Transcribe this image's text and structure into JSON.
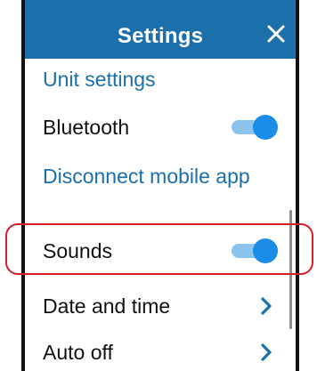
{
  "header": {
    "title": "Settings",
    "close_icon": "close-icon"
  },
  "menu": {
    "unit_settings": "Unit settings",
    "bluetooth": {
      "label": "Bluetooth",
      "toggle_on": true
    },
    "disconnect_app": "Disconnect mobile app",
    "sounds": {
      "label": "Sounds",
      "toggle_on": true
    },
    "date_time": "Date and time",
    "auto_off": "Auto off"
  },
  "colors": {
    "header_bg": "#1b6fab",
    "link": "#1b6fab",
    "toggle_knob": "#1b8de6",
    "toggle_track": "#8cc4ee",
    "highlight": "#d62027"
  }
}
